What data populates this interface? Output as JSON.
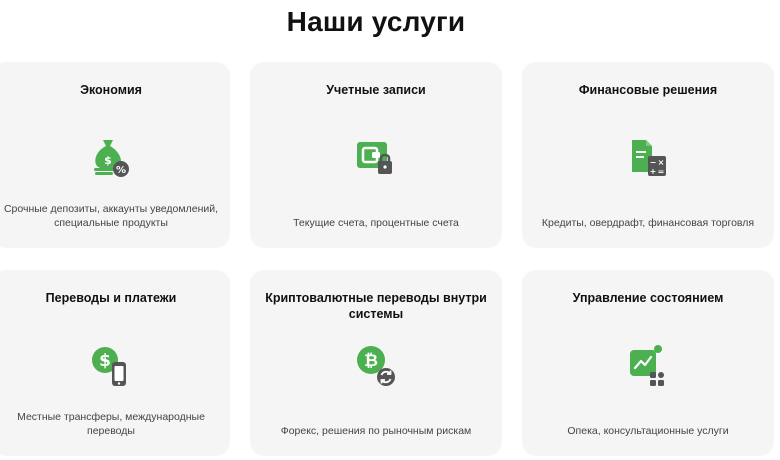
{
  "page": {
    "title": "Наши услуги"
  },
  "colors": {
    "accent_green": "#4caf50",
    "icon_dark_gray": "#555555",
    "card_bg": "#f5f5f5"
  },
  "services": [
    {
      "title": "Экономия",
      "description": "Срочные депозиты, аккаунты уведомлений, специальные продукты",
      "icon": "money-bag-percent-icon"
    },
    {
      "title": "Учетные записи",
      "description": "Текущие счета, процентные счета",
      "icon": "wallet-lock-icon"
    },
    {
      "title": "Финансовые решения",
      "description": "Кредиты, овердрафт, финансовая торговля",
      "icon": "document-calculator-icon"
    },
    {
      "title": "Переводы и платежи",
      "description": "Местные трансферы, международные переводы",
      "icon": "dollar-coin-phone-icon"
    },
    {
      "title": "Криптовалютные переводы внутри системы",
      "description": "Форекс, решения по рыночным рискам",
      "icon": "bitcoin-exchange-icon"
    },
    {
      "title": "Управление состоянием",
      "description": "Опека, консультационные услуги",
      "icon": "wealth-chart-icon"
    }
  ]
}
